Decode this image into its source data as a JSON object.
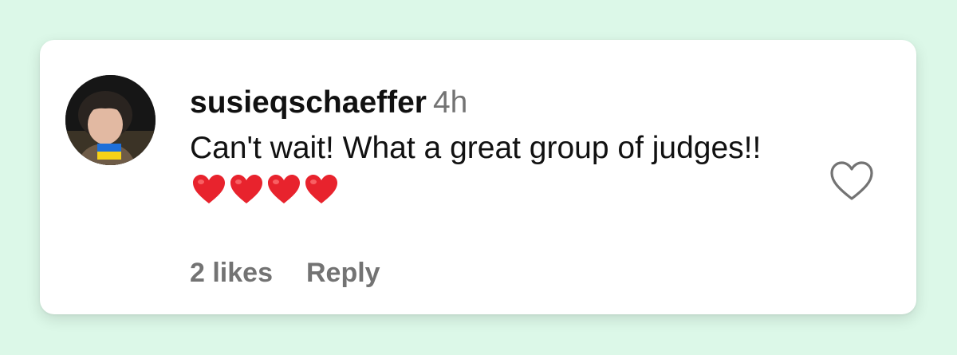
{
  "comment": {
    "username": "susieqschaeffer",
    "timestamp": "4h",
    "text": "Can't wait! What a great group of judges!!",
    "emoji": "❤️❤️❤️❤️",
    "heart_emoji_color": "#e8232d"
  },
  "actions": {
    "likes_label": "2 likes",
    "reply_label": "Reply"
  },
  "icons": {
    "like": "heart-outline-icon",
    "avatar_badge": "ukraine-flag-icon"
  },
  "colors": {
    "page_background": "#dcf8e8",
    "card_background": "#ffffff",
    "primary_text": "#111111",
    "secondary_text": "#737373",
    "flag_blue": "#1e6fd9",
    "flag_yellow": "#f7d217"
  }
}
